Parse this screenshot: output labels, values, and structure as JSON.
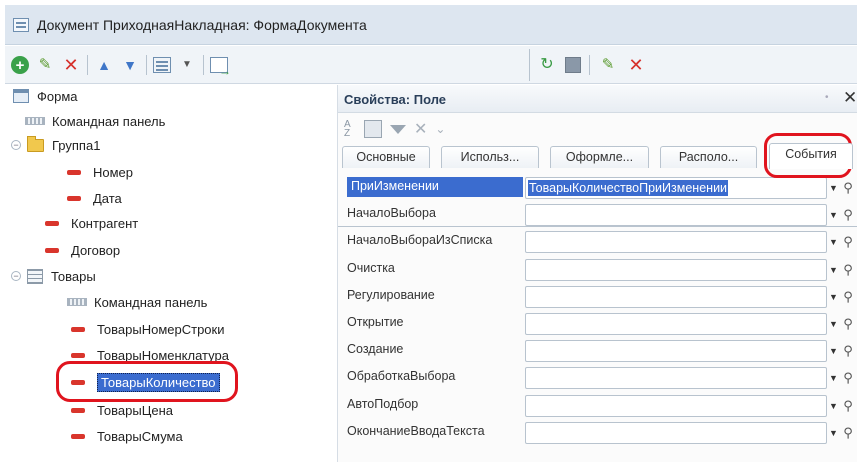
{
  "window": {
    "title": "Документ ПриходнаяНакладная: ФормаДокумента"
  },
  "toolbar": {
    "left_icons": [
      "add-icon",
      "edit-icon",
      "delete-icon",
      "move-up-icon",
      "move-down-icon",
      "list-view-icon",
      "dropdown-icon",
      "form-preview-icon"
    ],
    "right_icons": [
      "refresh-icon",
      "document-icon",
      "edit-icon",
      "delete-icon"
    ]
  },
  "tree": {
    "root": "Форма",
    "command_panel": "Командная панель",
    "group1": "Группа1",
    "number": "Номер",
    "date": "Дата",
    "counterparty": "Контрагент",
    "contract": "Договор",
    "goods": "Товары",
    "goods_command_panel": "Командная панель",
    "goods_line_number": "ТоварыНомерСтроки",
    "goods_nomenclature": "ТоварыНоменклатура",
    "goods_quantity": "ТоварыКоличество",
    "goods_price": "ТоварыЦена",
    "goods_sum": "ТоварыСмума"
  },
  "properties": {
    "title": "Свойства: Поле",
    "tabs": [
      "Основные",
      "Использ...",
      "Оформле...",
      "Располо...",
      "События"
    ],
    "active_tab": "События",
    "events": [
      {
        "name": "ПриИзменении",
        "value": "ТоварыКоличествоПриИзменении"
      },
      {
        "name": "НачалоВыбора",
        "value": ""
      },
      {
        "name": "НачалоВыбораИзСписка",
        "value": ""
      },
      {
        "name": "Очистка",
        "value": ""
      },
      {
        "name": "Регулирование",
        "value": ""
      },
      {
        "name": "Открытие",
        "value": ""
      },
      {
        "name": "Создание",
        "value": ""
      },
      {
        "name": "ОбработкаВыбора",
        "value": ""
      },
      {
        "name": "АвтоПодбор",
        "value": ""
      },
      {
        "name": "ОкончаниеВводаТекста",
        "value": ""
      }
    ]
  },
  "colors": {
    "highlight": "#e0141e",
    "selection": "#3b6ccf"
  }
}
